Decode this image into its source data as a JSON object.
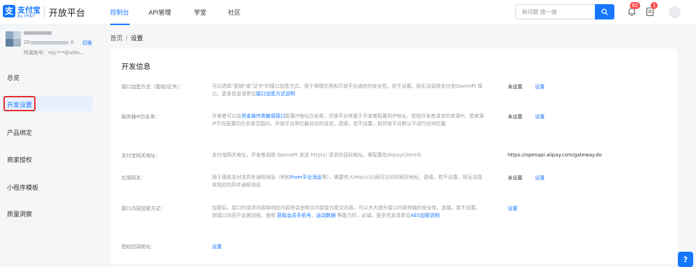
{
  "header": {
    "logo_name": "支付宝",
    "logo_sub": "ALIPAY",
    "platform_title": "开放平台",
    "nav": [
      {
        "label": "控制台",
        "active": true
      },
      {
        "label": "API管理",
        "active": false
      },
      {
        "label": "学堂",
        "active": false
      },
      {
        "label": "社区",
        "active": false
      }
    ],
    "search_placeholder": "有问题 搜一搜",
    "notification_badge": "82",
    "message_badge": "1"
  },
  "account": {
    "id_prefix": "20",
    "id_suffix": "0",
    "switch_label": "切换",
    "sub_account": "所属账号：mjc***@alite..."
  },
  "sidebar": {
    "items": [
      {
        "label": "总览",
        "active": false
      },
      {
        "label": "开发设置",
        "active": true
      },
      {
        "label": "产品绑定",
        "active": false
      },
      {
        "label": "商家授权",
        "active": false
      },
      {
        "label": "小程序模板",
        "active": false
      },
      {
        "label": "质量洞察",
        "active": false
      }
    ]
  },
  "breadcrumb": {
    "home": "首页",
    "sep": "/",
    "current": "设置"
  },
  "main": {
    "section_title": "开发信息",
    "rows": [
      {
        "label": "接口加签方式（密钥/证书）：",
        "desc_parts": [
          {
            "text": "可以选择\"密钥\"或\"证书\"的接口加签方式，用于保障应用和开放平台通信的安全性。若不设置，则无法调用支付宝OpenAPI 接口。更多信息请参见",
            "link": false
          },
          {
            "text": "接口加签方式说明",
            "link": true
          }
        ],
        "status": "未设置",
        "action": "设置"
      },
      {
        "label": "服务器IP白名单：",
        "desc_parts": [
          {
            "text": "开发者可以给",
            "link": false
          },
          {
            "text": "资金操作类敏感接口",
            "link": true
          },
          {
            "text": "配置IP地址白名单，开放平台将基于开发者配置的IP地址，校验开发者请求的来源IP。若来源IP不在配置的白名单范围内，开放平台将拦截对应的请求。选填，若不设置，则开放平台默认不进行任何拦截",
            "link": false
          }
        ],
        "status": "未设置",
        "action": "设置"
      },
      {
        "label": "支付宝网关地址：",
        "desc_parts": [
          {
            "text": "支付宝网关地址，开发者调用 OpenAPI 发送 http(s) 请求的目标地址。需配置在AlipayClient中",
            "link": false
          }
        ],
        "status": "https://openapi.alipay.com/gateway.do",
        "action": ""
      },
      {
        "label": "应用网关：",
        "desc_parts": [
          {
            "text": "用于接收支付宝异步通知消息（例如",
            "link": false
          },
          {
            "text": "From平台消息",
            "link": true
          },
          {
            "text": "等），需要传入http(s)公网可访问的网页地址。选填，若不设置，则无法接收相应的异步通知消息",
            "link": false
          }
        ],
        "status": "未设置",
        "action": "设置"
      },
      {
        "label": "接口内容加密方式：",
        "desc_parts": [
          {
            "text": "加密后，接口的请求内容和响应内容将会由明文内容变为密文内容，可以大大提升接口内容传输的安全性。选填，若不设置，则接口内容不会被加密。使用 ",
            "link": false
          },
          {
            "text": "获取会员手机号",
            "link": true
          },
          {
            "text": "、",
            "link": false
          },
          {
            "text": "运动数据",
            "link": true
          },
          {
            "text": " 等能力时，必填。更多信息请参见",
            "link": false
          },
          {
            "text": "AES加密说明",
            "link": true
          }
        ],
        "status": "",
        "action": "设置"
      },
      {
        "label": "授权回调地址：",
        "desc_parts": [],
        "status": "",
        "action": "设置"
      }
    ]
  },
  "colors": {
    "brand": "#1677ff",
    "highlight": "#e5302e",
    "badge": "#ff4d4f"
  }
}
